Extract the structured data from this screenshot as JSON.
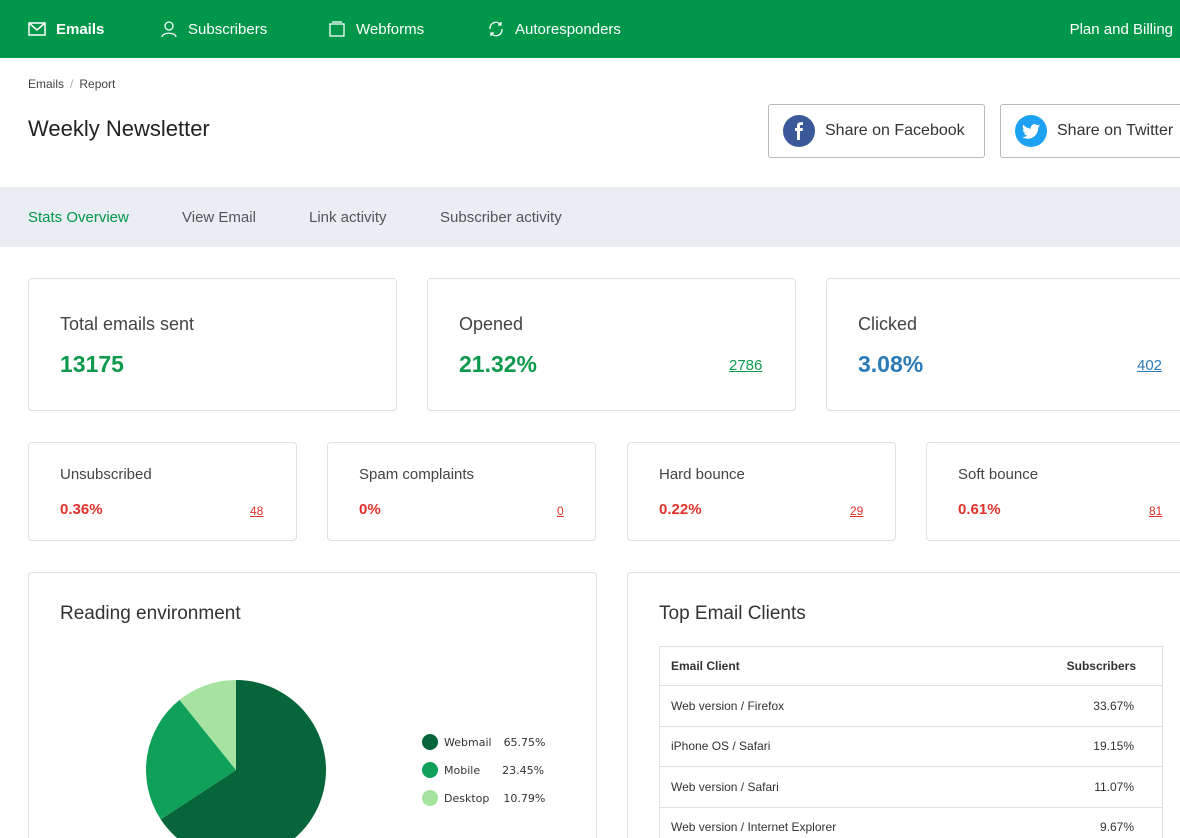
{
  "nav": {
    "items": [
      {
        "label": "Emails",
        "icon": "mail-icon",
        "active": true
      },
      {
        "label": "Subscribers",
        "icon": "user-icon"
      },
      {
        "label": "Webforms",
        "icon": "form-icon"
      },
      {
        "label": "Autoresponders",
        "icon": "refresh-icon"
      }
    ],
    "plan_label": "Plan and Billing"
  },
  "breadcrumb": {
    "root": "Emails",
    "separator": "/",
    "current": "Report"
  },
  "page_title": "Weekly Newsletter",
  "share": {
    "facebook_label": "Share on Facebook",
    "twitter_label": "Share on Twitter"
  },
  "tabs": [
    "Stats Overview",
    "View Email",
    "Link activity",
    "Subscriber activity"
  ],
  "stats_main": [
    {
      "label": "Total emails sent",
      "value": "13175",
      "link": ""
    },
    {
      "label": "Opened",
      "value": "21.32%",
      "link": "2786"
    },
    {
      "label": "Clicked",
      "value": "3.08%",
      "link": "402"
    }
  ],
  "stats_secondary": [
    {
      "label": "Unsubscribed",
      "value": "0.36%",
      "link": "48"
    },
    {
      "label": "Spam complaints",
      "value": "0%",
      "link": "0"
    },
    {
      "label": "Hard bounce",
      "value": "0.22%",
      "link": "29"
    },
    {
      "label": "Soft bounce",
      "value": "0.61%",
      "link": "81"
    }
  ],
  "reading": {
    "title": "Reading environment",
    "legend": [
      {
        "label": "Webmail",
        "pct": "65.75%"
      },
      {
        "label": "Mobile",
        "pct": "23.45%"
      },
      {
        "label": "Desktop",
        "pct": "10.79%"
      }
    ]
  },
  "chart_data": {
    "type": "pie",
    "categories": [
      "Webmail",
      "Mobile",
      "Desktop"
    ],
    "values": [
      65.75,
      23.45,
      10.79
    ],
    "colors": [
      "#07653a",
      "#0fa05a",
      "#a6e3a0"
    ],
    "legend": "right"
  },
  "clients": {
    "title": "Top Email Clients",
    "headers": [
      "Email Client",
      "Subscribers"
    ],
    "rows": [
      [
        "Web version / Firefox",
        "33.67%"
      ],
      [
        "iPhone OS / Safari",
        "19.15%"
      ],
      [
        "Web version / Safari",
        "11.07%"
      ],
      [
        "Web version / Internet Explorer",
        "9.67%"
      ]
    ]
  },
  "colors": {
    "brand": "#00974a",
    "accent_green": "#0e9a4c",
    "accent_blue": "#2a7ab8",
    "alert_red": "#e0322b",
    "tab_bar": "#eaedf3"
  }
}
